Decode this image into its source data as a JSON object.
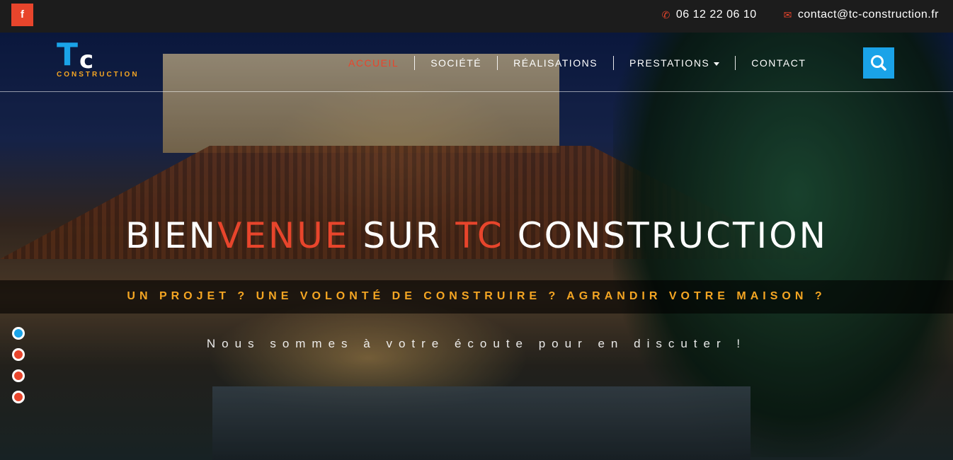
{
  "topbar": {
    "facebook_icon": "facebook-icon",
    "phone": "06 12 22 06 10",
    "email": "contact@tc-construction.fr"
  },
  "logo": {
    "letter_t": "T",
    "letter_c": "c",
    "subtitle": "CONSTRUCTION"
  },
  "nav": {
    "items": [
      {
        "label": "ACCUEIL",
        "active": true
      },
      {
        "label": "SOCIÉTÉ"
      },
      {
        "label": "RÉALISATIONS"
      },
      {
        "label": "PRESTATIONS"
      },
      {
        "label": "CONTACT"
      }
    ],
    "search_icon": "search-icon"
  },
  "hero": {
    "headline_part1": "BIEN",
    "headline_part2": "VENUE",
    "headline_part3": " SUR ",
    "headline_part4": "TC",
    "headline_part5": " CONSTRUCTION",
    "tagline": "UN PROJET ? UNE VOLONTÉ DE CONSTRUIRE ? AGRANDIR VOTRE MAISON ?",
    "subtext": "Nous sommes à votre écoute pour en discuter !",
    "slides": 4,
    "active_slide": 1
  },
  "colors": {
    "accent": "#e8452c",
    "brand_blue": "#1aa3e8",
    "gold": "#f5a623",
    "topbar": "#1c1c1c"
  }
}
